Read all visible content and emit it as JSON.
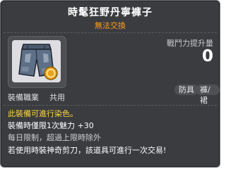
{
  "item": {
    "title": "時髦狂野丹寧褲子",
    "subtitle": "無法交換"
  },
  "stats": {
    "label": "戰鬥力提升量",
    "value": "0"
  },
  "requirement": {
    "label": "裝備職業",
    "value": "共用"
  },
  "tags": [
    "防具",
    "褲/裙"
  ],
  "lines": [
    "此裝備可進行染色。",
    "裝備時僅限1次魅力 +30",
    "每日限制，超過上限時除外",
    "若使用時裝神奇剪刀，該道具可進行一次交易!"
  ],
  "colors": {
    "background": "#3a3c40",
    "title": "#ffffff",
    "subtitle": "#ff9c1a",
    "dye_line": "#ffd73c"
  }
}
